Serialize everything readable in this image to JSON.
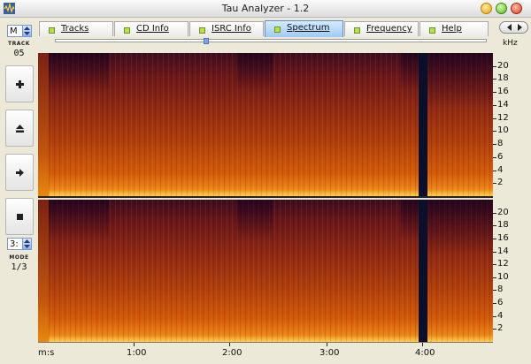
{
  "window": {
    "title": "Tau Analyzer - 1.2",
    "icons": {
      "app": "waveform-app-icon",
      "minimize": "minimize-icon",
      "maximize": "maximize-icon",
      "close": "close-icon"
    }
  },
  "sidebar": {
    "mode_select": "M",
    "track_label": "TRACK",
    "track_number": "05",
    "buttons": [
      {
        "name": "add-button",
        "icon": "plus-icon"
      },
      {
        "name": "eject-button",
        "icon": "eject-icon"
      },
      {
        "name": "play-button",
        "icon": "play-arrow-icon"
      },
      {
        "name": "stop-button",
        "icon": "stop-square-icon"
      }
    ],
    "channel_select": "3:",
    "mode_label": "MODE",
    "mode_value": "1/3"
  },
  "tabs": [
    {
      "label": "Tracks",
      "active": false
    },
    {
      "label": "CD Info",
      "active": false
    },
    {
      "label": "ISRC Info",
      "active": false
    },
    {
      "label": "Spectrum",
      "active": true
    },
    {
      "label": "Frequency",
      "active": false
    },
    {
      "label": "Help",
      "active": false
    }
  ],
  "nav": {
    "icon": "scroll-left-right-icon"
  },
  "slider": {
    "position": 0.35
  },
  "spectrum": {
    "unit": "kHz",
    "freq_ticks": [
      "20",
      "18",
      "16",
      "14",
      "12",
      "10",
      "8",
      "6",
      "4",
      "2"
    ],
    "time_axis_label": "m:s",
    "time_ticks": [
      "1:00",
      "2:00",
      "3:00",
      "4:00"
    ],
    "colors": {
      "low": "#3d0c20",
      "mid": "#b03e0c",
      "high": "#ffd14d",
      "separator": "#0b0f2a"
    }
  }
}
